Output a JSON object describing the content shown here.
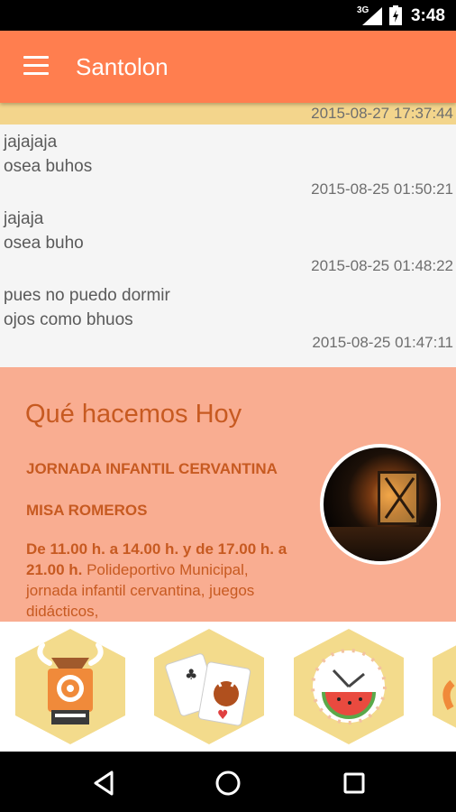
{
  "status_bar": {
    "network": "3G",
    "time": "3:48"
  },
  "app_bar": {
    "title": "Santolon"
  },
  "feed": {
    "first_timestamp": "2015-08-27 17:37:44",
    "messages": [
      {
        "line1": "jajajaja",
        "line2": "osea buhos",
        "timestamp": "2015-08-25 01:50:21"
      },
      {
        "line1": "jajaja",
        "line2": "osea buho",
        "timestamp": "2015-08-25 01:48:22"
      },
      {
        "line1": "pues no puedo dormir",
        "line2": "ojos como bhuos",
        "timestamp": "2015-08-25 01:47:11"
      }
    ]
  },
  "today": {
    "title": "Qué hacemos Hoy",
    "events": [
      "JORNADA INFANTIL CERVANTINA",
      "MISA ROMEROS"
    ],
    "description_bold": "De 11.00 h. a 14.00 h. y de 17.00 h. a 21.00 h.",
    "description_text": " Polideportivo Municipal, jornada infantil cervantina, juegos didácticos,"
  },
  "categories": [
    {
      "icon": "bull-camera-icon"
    },
    {
      "icon": "cards-bull-icon"
    },
    {
      "icon": "watermelon-clock-icon"
    },
    {
      "icon": "partial-category-icon"
    }
  ],
  "colors": {
    "accent": "#ff7e4f",
    "today_bg": "#f9ad91",
    "today_text": "#c75a21",
    "hex": "#f3db8c"
  }
}
